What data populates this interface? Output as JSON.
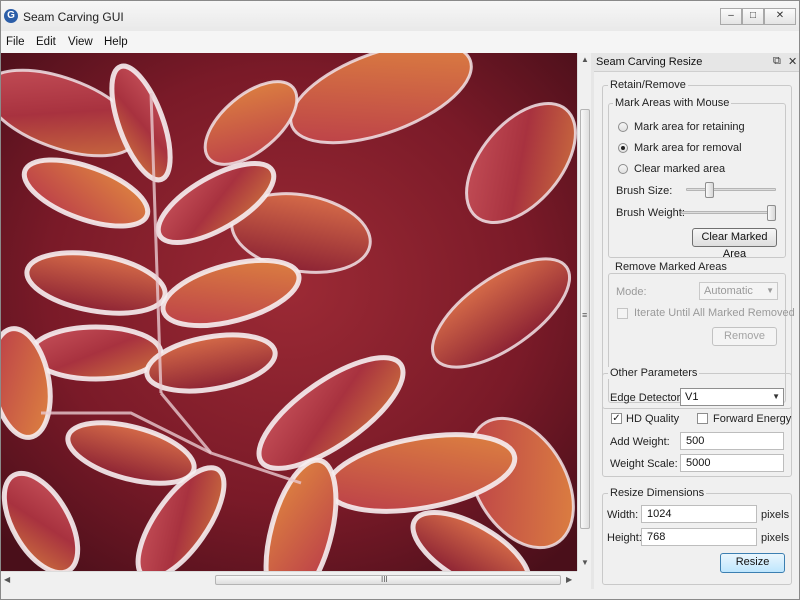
{
  "window": {
    "title": "Seam Carving GUI",
    "app_icon_letter": "G",
    "minimize": "–",
    "maximize": "□",
    "close": "✕"
  },
  "menu": [
    "File",
    "Edit",
    "View",
    "Help"
  ],
  "canvas": {
    "image": "frosted-red-leaves"
  },
  "scroll": {
    "v_grip": "≡",
    "h_grip": "III",
    "up": "▲",
    "down": "▼",
    "left": "◀",
    "right": "▶"
  },
  "dock": {
    "title": "Seam Carving Resize",
    "float_icon": "⧉",
    "close_icon": "✕",
    "retain_remove": {
      "title": "Retain/Remove",
      "mark_areas": {
        "title": "Mark Areas with Mouse",
        "options": [
          "Mark area for retaining",
          "Mark area for removal",
          "Clear marked area"
        ],
        "selected_index": 1,
        "brush_size_label": "Brush Size:",
        "brush_size_level": 0.24,
        "brush_weight_label": "Brush Weight:",
        "brush_weight_level": 1.0,
        "clear_button": "Clear Marked Area"
      },
      "remove_marked": {
        "title": "Remove Marked Areas",
        "mode_label": "Mode:",
        "mode_value": "Automatic",
        "iterate_label": "Iterate Until All Marked Removed",
        "iterate_checked": false,
        "remove_button": "Remove"
      }
    },
    "other_params": {
      "title": "Other Parameters",
      "edge_detector_label": "Edge Detector:",
      "edge_detector_value": "V1",
      "hd_quality_label": "HD Quality",
      "hd_quality_checked": true,
      "forward_energy_label": "Forward Energy",
      "forward_energy_checked": false,
      "add_weight_label": "Add Weight:",
      "add_weight_value": "500",
      "weight_scale_label": "Weight Scale:",
      "weight_scale_value": "5000"
    },
    "resize": {
      "title": "Resize Dimensions",
      "width_label": "Width:",
      "width_value": "1024",
      "height_label": "Height:",
      "height_value": "768",
      "unit": "pixels",
      "resize_button": "Resize"
    }
  },
  "colors": {
    "accent": "#3c7fb1",
    "leaf_red": "#b8384a",
    "leaf_orange": "#d9743a",
    "frost": "#f2e6ea"
  }
}
